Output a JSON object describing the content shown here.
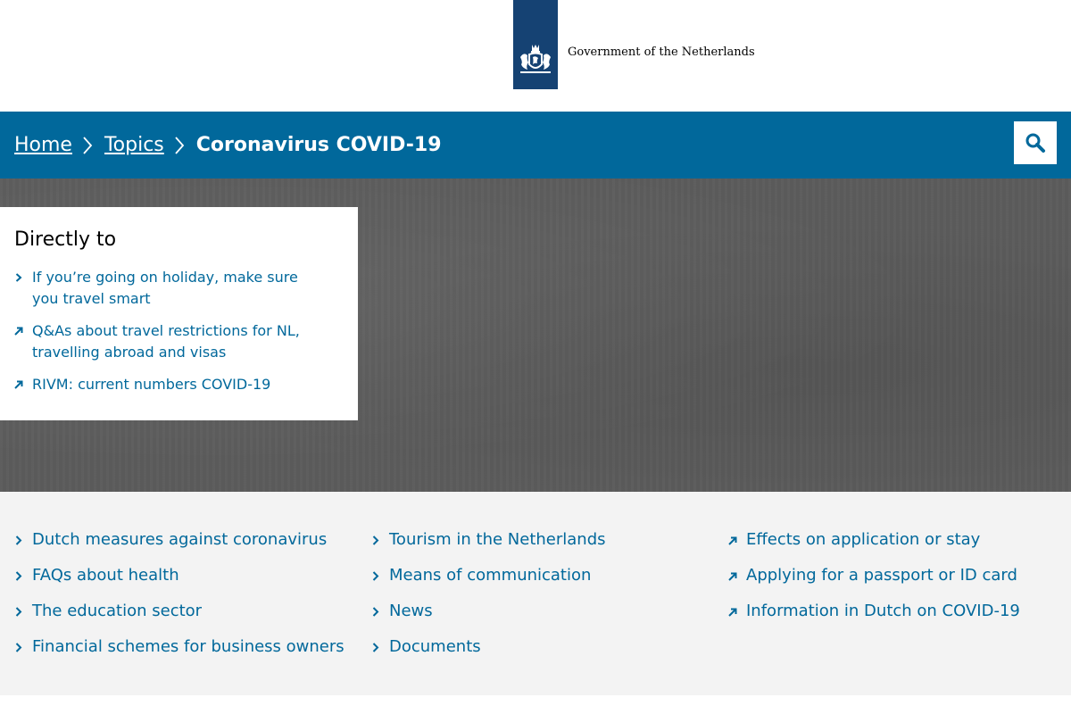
{
  "header": {
    "org_name": "Government of the Netherlands",
    "logo_color": "#154273"
  },
  "nav": {
    "bg_color": "#01689b",
    "breadcrumbs": [
      {
        "label": "Home"
      },
      {
        "label": "Topics"
      },
      {
        "label": "Coronavirus COVID-19"
      }
    ],
    "search_icon": "search-icon"
  },
  "directly_to": {
    "title": "Directly to",
    "items": [
      {
        "label": "If you’re going on holiday, make sure you travel smart",
        "icon": "chevron-right-icon"
      },
      {
        "label": "Q&As about travel restrictions for NL, travelling abroad and visas",
        "icon": "external-link-icon"
      },
      {
        "label": "RIVM: current numbers COVID-19",
        "icon": "external-link-icon"
      }
    ]
  },
  "links": {
    "col1": [
      {
        "label": "Dutch measures against coronavirus",
        "icon": "chevron-right-icon"
      },
      {
        "label": "FAQs about health",
        "icon": "chevron-right-icon"
      },
      {
        "label": "The education sector",
        "icon": "chevron-right-icon"
      },
      {
        "label": "Financial schemes for business owners",
        "icon": "chevron-right-icon"
      }
    ],
    "col2": [
      {
        "label": "Tourism in the Netherlands",
        "icon": "chevron-right-icon"
      },
      {
        "label": "Means of communication",
        "icon": "chevron-right-icon"
      },
      {
        "label": "News",
        "icon": "chevron-right-icon"
      },
      {
        "label": "Documents",
        "icon": "chevron-right-icon"
      }
    ],
    "col3": [
      {
        "label": "Effects on application or stay",
        "icon": "external-link-icon"
      },
      {
        "label": "Applying for a passport or ID card",
        "icon": "external-link-icon"
      },
      {
        "label": "Information in Dutch on COVID-19",
        "icon": "external-link-icon"
      }
    ]
  }
}
